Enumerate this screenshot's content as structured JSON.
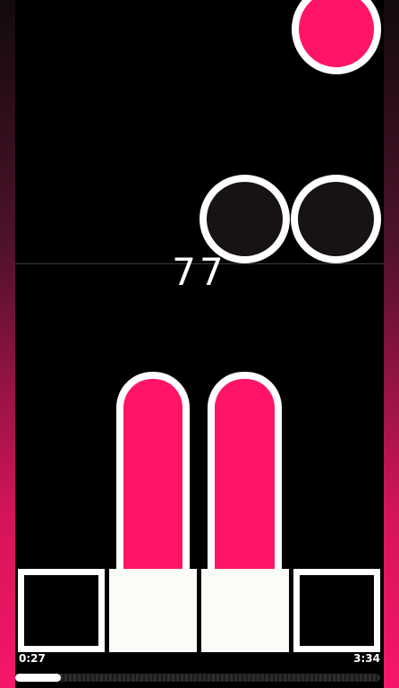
{
  "game": {
    "combo": "77",
    "lanes": 4,
    "accent_color": "#ff1468",
    "background_color": "#000000"
  },
  "notes": [
    {
      "lane": 4,
      "kind": "tap",
      "color": "#ff1468"
    },
    {
      "lane": 3,
      "kind": "tap-empty",
      "color": "#171313"
    },
    {
      "lane": 4,
      "kind": "tap-empty",
      "color": "#171313"
    }
  ],
  "holds": [
    {
      "lane": 2,
      "color": "#ff1468"
    },
    {
      "lane": 3,
      "color": "#ff1468"
    }
  ],
  "pads": [
    {
      "lane": 1,
      "state": "inactive"
    },
    {
      "lane": 2,
      "state": "pressed"
    },
    {
      "lane": 3,
      "state": "pressed"
    },
    {
      "lane": 4,
      "state": "inactive"
    }
  ],
  "playback": {
    "elapsed": "0:27",
    "total": "3:34",
    "progress_fraction": 0.126
  }
}
